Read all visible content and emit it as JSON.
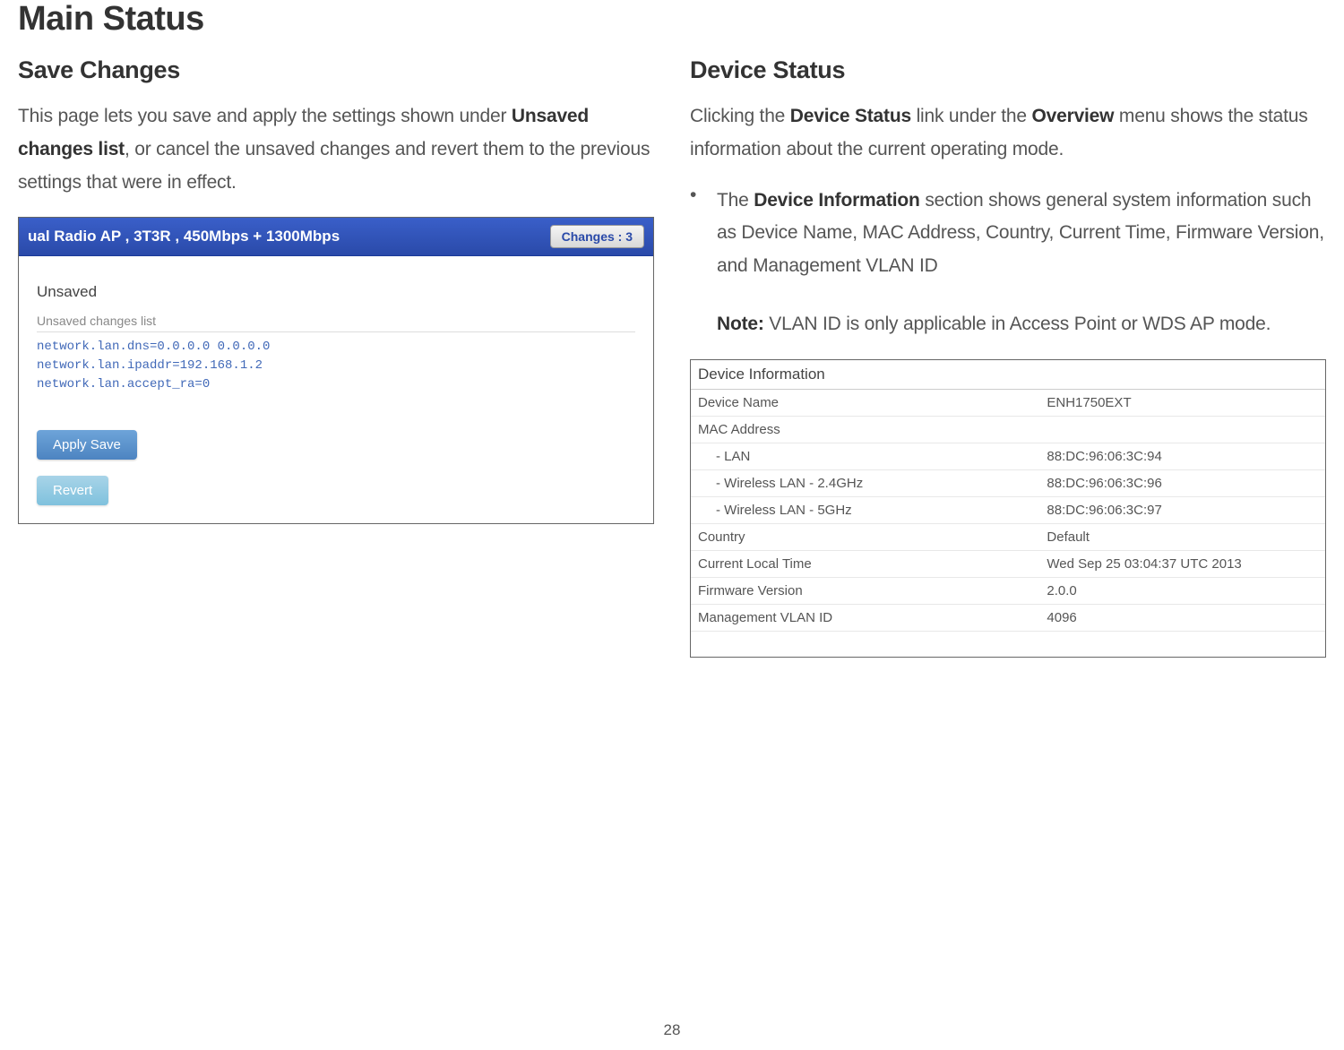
{
  "page_title": "Main Status",
  "page_number": "28",
  "left": {
    "heading": "Save Changes",
    "para_pre": "This page lets you save and apply the settings shown under ",
    "para_bold": "Unsaved changes list",
    "para_post": ", or cancel the unsaved changes and revert them to the previous settings that were in effect.",
    "ap_header_title": "ual Radio AP , 3T3R , 450Mbps + 1300Mbps",
    "changes_btn": "Changes : 3",
    "unsaved_title": "Unsaved",
    "unsaved_list_label": "Unsaved changes list",
    "unsaved_lines": "network.lan.dns=0.0.0.0 0.0.0.0\nnetwork.lan.ipaddr=192.168.1.2\nnetwork.lan.accept_ra=0",
    "apply_label": "Apply Save",
    "revert_label": "Revert"
  },
  "right": {
    "heading": "Device Status",
    "para_pre": "Clicking the ",
    "para_b1": "Device Status",
    "para_mid": " link under the ",
    "para_b2": "Overview",
    "para_post": " menu shows the status information about the current operating mode.",
    "bullet_pre": "The ",
    "bullet_b": "Device Information",
    "bullet_post": " section shows general system information such as Device Name, MAC Address, Country, Current Time, Firmware Version, and Management VLAN ID",
    "note_b": "Note:",
    "note_text": " VLAN ID is only applicable in Access Point or WDS AP mode.",
    "dev_header": "Device Information",
    "table": {
      "device_name_label": "Device Name",
      "device_name_value": "ENH1750EXT",
      "mac_label": "MAC Address",
      "lan_label": "- LAN",
      "lan_value": "88:DC:96:06:3C:94",
      "wlan24_label": "- Wireless LAN - 2.4GHz",
      "wlan24_value": "88:DC:96:06:3C:96",
      "wlan5_label": "- Wireless LAN - 5GHz",
      "wlan5_value": "88:DC:96:06:3C:97",
      "country_label": "Country",
      "country_value": "Default",
      "time_label": "Current Local Time",
      "time_value": "Wed Sep 25 03:04:37 UTC 2013",
      "fw_label": "Firmware Version",
      "fw_value": "2.0.0",
      "vlan_label": "Management VLAN ID",
      "vlan_value": "4096"
    }
  }
}
